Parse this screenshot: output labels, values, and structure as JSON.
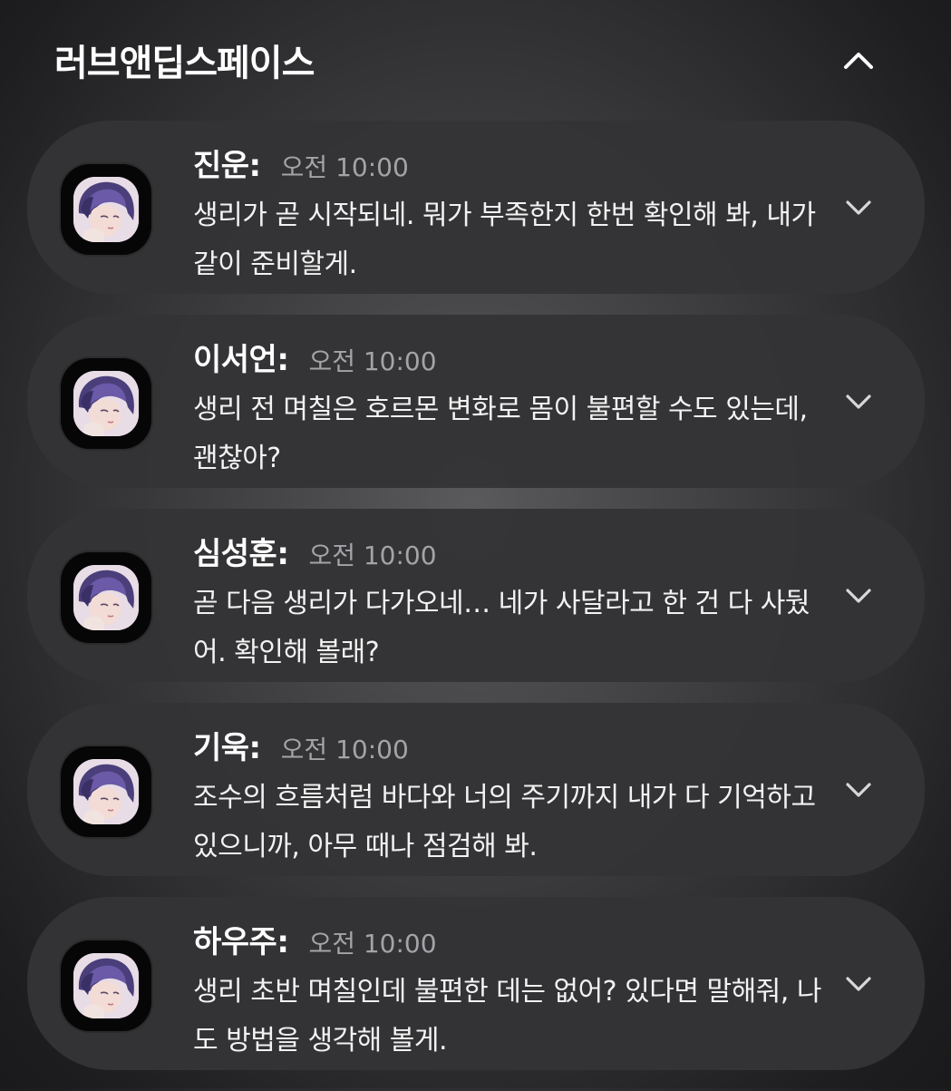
{
  "group": {
    "app_name": "러브앤딥스페이스",
    "collapse_icon": "chevron-up-icon"
  },
  "notifications": [
    {
      "sender": "진운:",
      "time": "오전 10:00",
      "message": "생리가 곧 시작되네. 뭐가 부족한지 한번 확인해 봐, 내가 같이 준비할게."
    },
    {
      "sender": "이서언:",
      "time": "오전 10:00",
      "message": "생리 전 며칠은 호르몬 변화로 몸이 불편할 수도 있는데, 괜찮아?"
    },
    {
      "sender": "심성훈:",
      "time": "오전 10:00",
      "message": "곧 다음 생리가 다가오네… 네가 사달라고 한 건 다 사뒀어. 확인해 볼래?"
    },
    {
      "sender": "기욱:",
      "time": "오전 10:00",
      "message": "조수의 흐름처럼 바다와 너의 주기까지 내가 다 기억하고 있으니까, 아무 때나 점검해 봐."
    },
    {
      "sender": "하우주:",
      "time": "오전 10:00",
      "message": "생리 초반 며칠인데 불편한 데는 없어? 있다면 말해줘, 나도 방법을 생각해 볼게."
    }
  ],
  "colors": {
    "card_background": "#343436",
    "time_text": "#a4a4a8",
    "message_text": "#f2f2f2"
  }
}
